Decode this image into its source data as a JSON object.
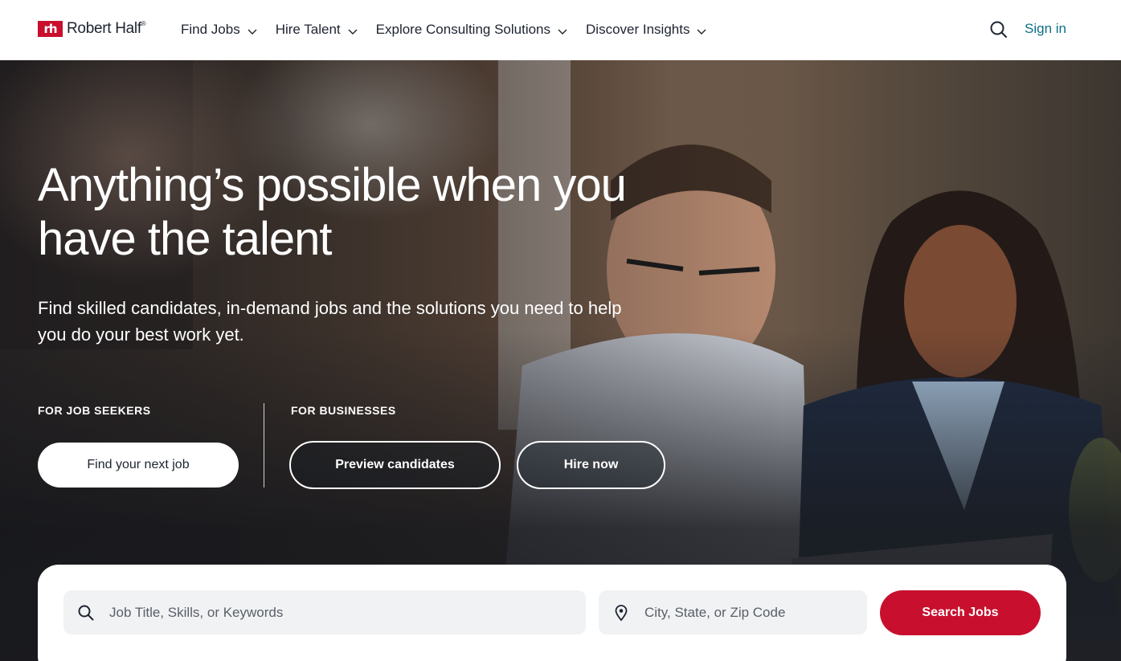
{
  "header": {
    "logo_mark": "rh",
    "logo_text": "Robert Half",
    "logo_reg": "®",
    "nav": [
      {
        "label": "Find Jobs",
        "icon": "chevron-down-icon"
      },
      {
        "label": "Hire Talent",
        "icon": "chevron-down-icon"
      },
      {
        "label": "Explore Consulting Solutions",
        "icon": "chevron-down-icon"
      },
      {
        "label": "Discover Insights",
        "icon": "chevron-down-icon"
      }
    ],
    "search_icon": "search-icon",
    "signin_label": "Sign in"
  },
  "hero": {
    "headline": "Anything’s possible when you have the talent",
    "subhead": "Find skilled candidates, in-demand jobs and the solutions you need to help you do your best work yet.",
    "job_seekers": {
      "label": "FOR JOB SEEKERS",
      "button": "Find your next job"
    },
    "businesses": {
      "label": "FOR BUSINESSES",
      "preview_button": "Preview candidates",
      "hire_button": "Hire now"
    }
  },
  "search": {
    "keyword_placeholder": "Job Title, Skills, or Keywords",
    "keyword_value": "",
    "location_placeholder": "City, State, or Zip Code",
    "location_value": "",
    "submit_label": "Search Jobs"
  },
  "colors": {
    "brand_red": "#c8102e",
    "link_teal": "#0d6e86",
    "text_dark": "#1d2430"
  }
}
